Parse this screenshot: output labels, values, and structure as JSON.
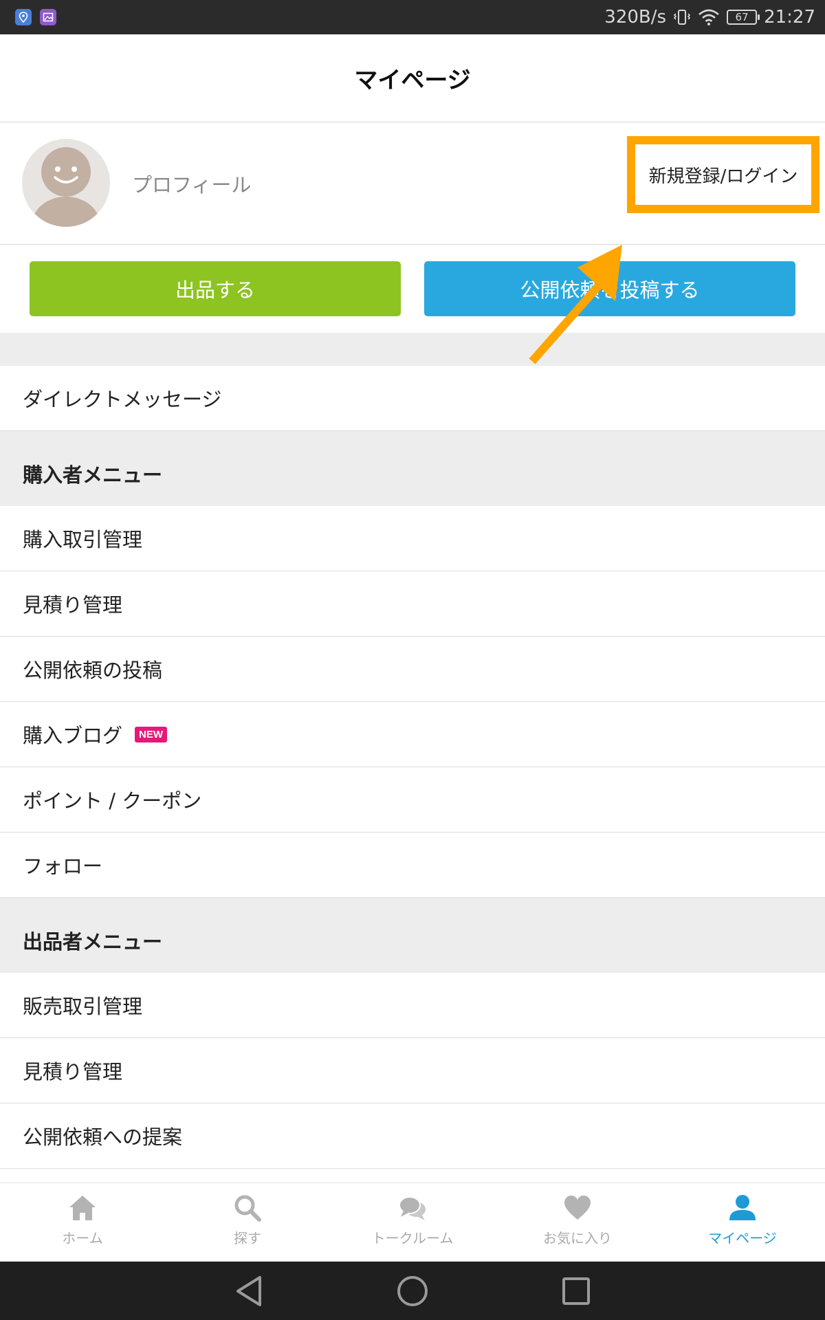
{
  "status_bar": {
    "net_speed": "320B/s",
    "battery": "67",
    "time": "21:27",
    "icons": [
      "location-app-icon",
      "gallery-app-icon",
      "vibrate-icon",
      "wifi-icon",
      "battery-icon"
    ]
  },
  "header": {
    "title": "マイページ"
  },
  "profile": {
    "label": "プロフィール",
    "login_label": "新規登録/ログイン"
  },
  "actions": {
    "sell_label": "出品する",
    "request_label": "公開依頼を投稿する"
  },
  "menu": {
    "direct_message": "ダイレクトメッセージ",
    "buyer_header": "購入者メニュー",
    "buyer_items": [
      {
        "label": "購入取引管理"
      },
      {
        "label": "見積り管理"
      },
      {
        "label": "公開依頼の投稿"
      },
      {
        "label": "購入ブログ",
        "badge": "NEW"
      },
      {
        "label": "ポイント / クーポン"
      },
      {
        "label": "フォロー"
      }
    ],
    "seller_header": "出品者メニュー",
    "seller_items": [
      {
        "label": "販売取引管理"
      },
      {
        "label": "見積り管理"
      },
      {
        "label": "公開依頼への提案"
      }
    ]
  },
  "tabbar": {
    "items": [
      {
        "label": "ホーム",
        "icon": "home-icon"
      },
      {
        "label": "探す",
        "icon": "search-icon"
      },
      {
        "label": "トークルーム",
        "icon": "chat-icon"
      },
      {
        "label": "お気に入り",
        "icon": "heart-icon"
      },
      {
        "label": "マイページ",
        "icon": "user-icon",
        "active": true
      }
    ]
  },
  "colors": {
    "highlight": "#ffa500",
    "sell_button": "#8dc421",
    "request_button": "#29a8df",
    "active_tab": "#1e9bd7",
    "new_badge": "#e6197a"
  }
}
